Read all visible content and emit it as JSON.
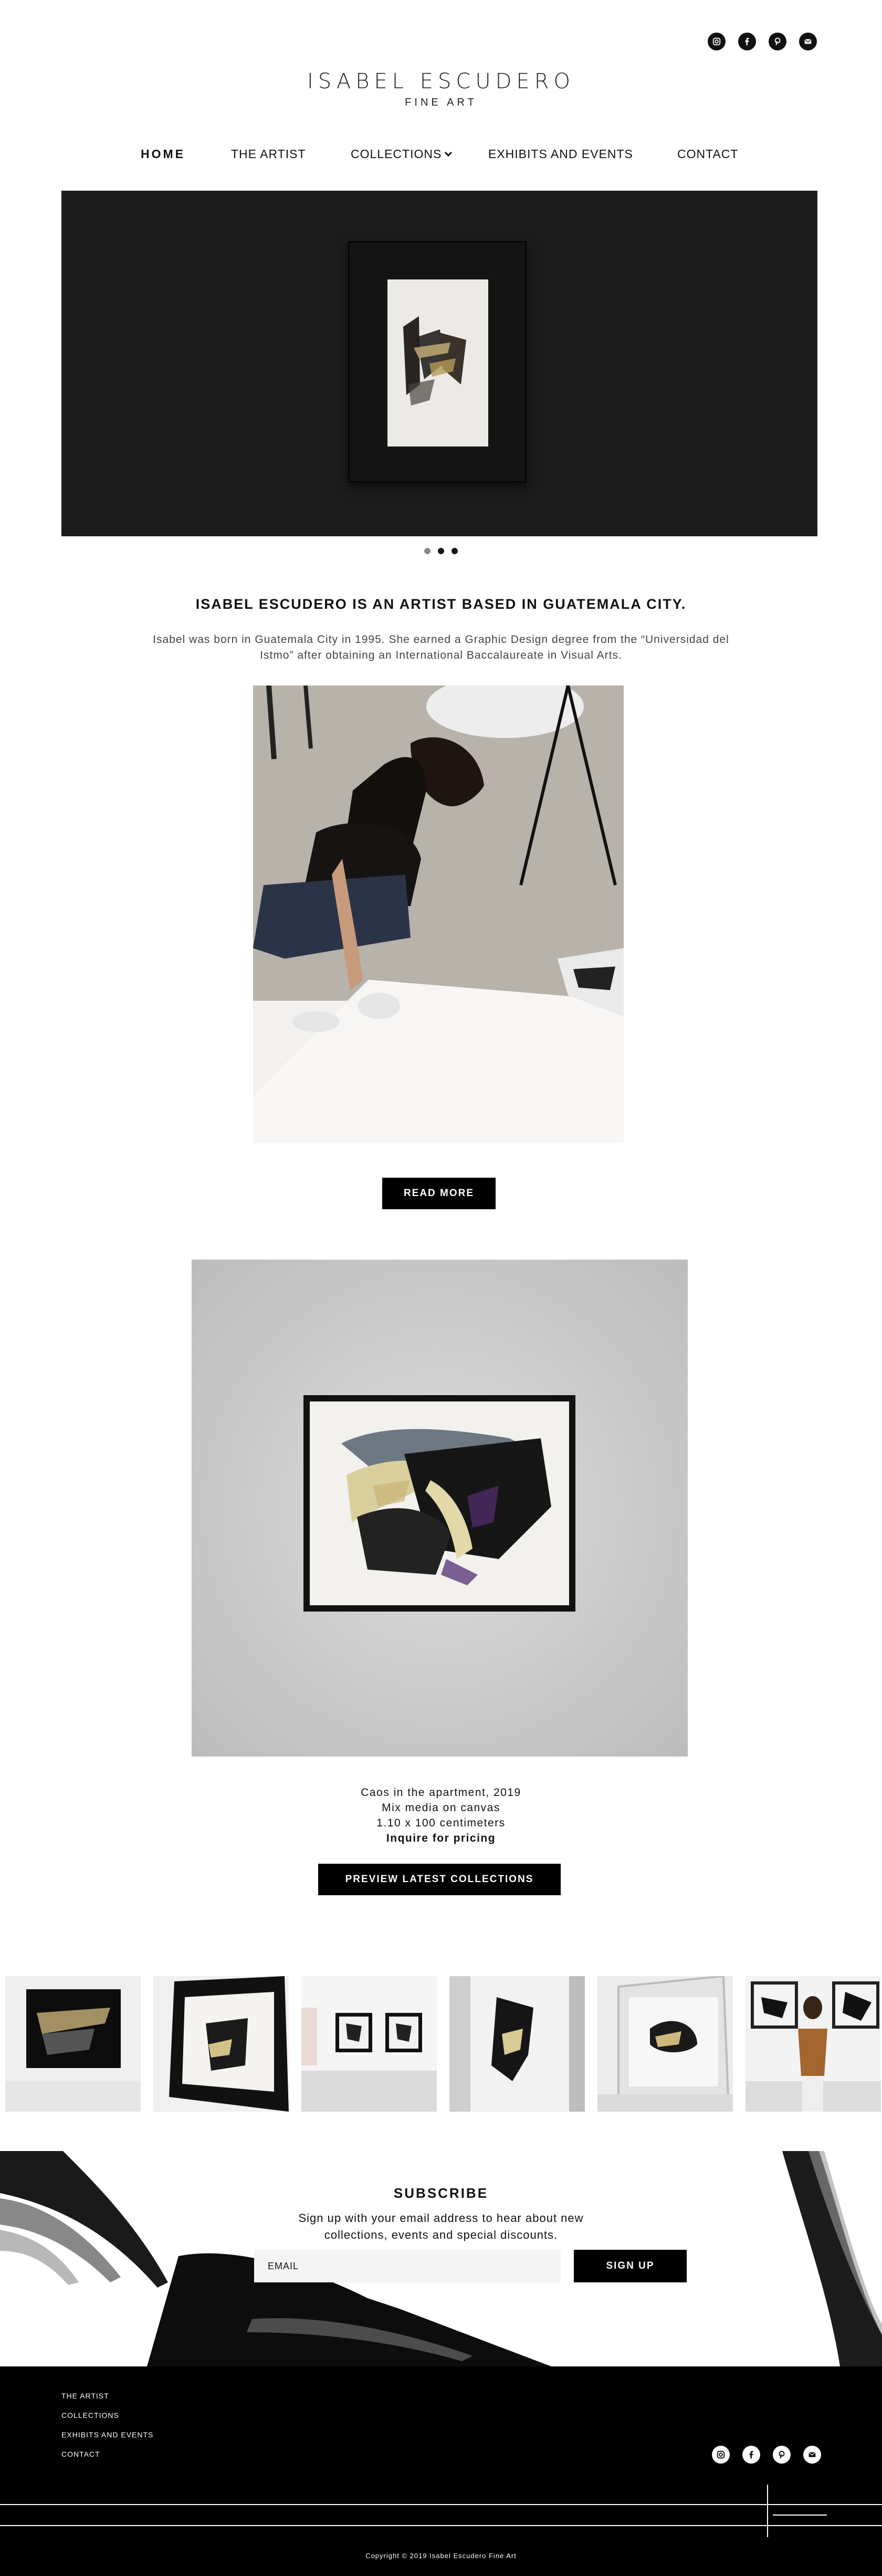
{
  "header": {
    "brand_name": "ISABEL ESCUDERO",
    "brand_sub": "FINE ART",
    "social": [
      "instagram-icon",
      "facebook-icon",
      "pinterest-icon",
      "email-icon"
    ]
  },
  "nav": {
    "home": "HOME",
    "artist": "THE ARTIST",
    "collections": "COLLECTIONS",
    "exhibits": "EXHIBITS AND EVENTS",
    "contact": "CONTACT"
  },
  "carousel": {
    "slides": 3,
    "active": 2
  },
  "about": {
    "headline": "ISABEL ESCUDERO IS AN ARTIST BASED IN GUATEMALA CITY.",
    "bio": "Isabel was born in Guatemala City in 1995. She earned a Graphic Design degree from the “Universidad del Istmo” after obtaining an International Baccalaureate in Visual Arts.",
    "read_more": "READ MORE"
  },
  "featured": {
    "title": "Caos in the apartment, 2019",
    "medium": "Mix media on canvas",
    "size": "1.10 x 100 centimeters",
    "pricing": "Inquire for pricing",
    "button": "PREVIEW LATEST COLLECTIONS"
  },
  "subscribe": {
    "title": "SUBSCRIBE",
    "text": "Sign up with your email address to hear about new collections, events and special discounts.",
    "placeholder": "EMAIL",
    "button": "SIGN UP"
  },
  "footer": {
    "links": [
      "THE ARTIST",
      "COLLECTIONS",
      "EXHIBITS AND EVENTS",
      "CONTACT"
    ],
    "copyright": "Copyright © 2019 Isabel Escudero Fine Art"
  }
}
